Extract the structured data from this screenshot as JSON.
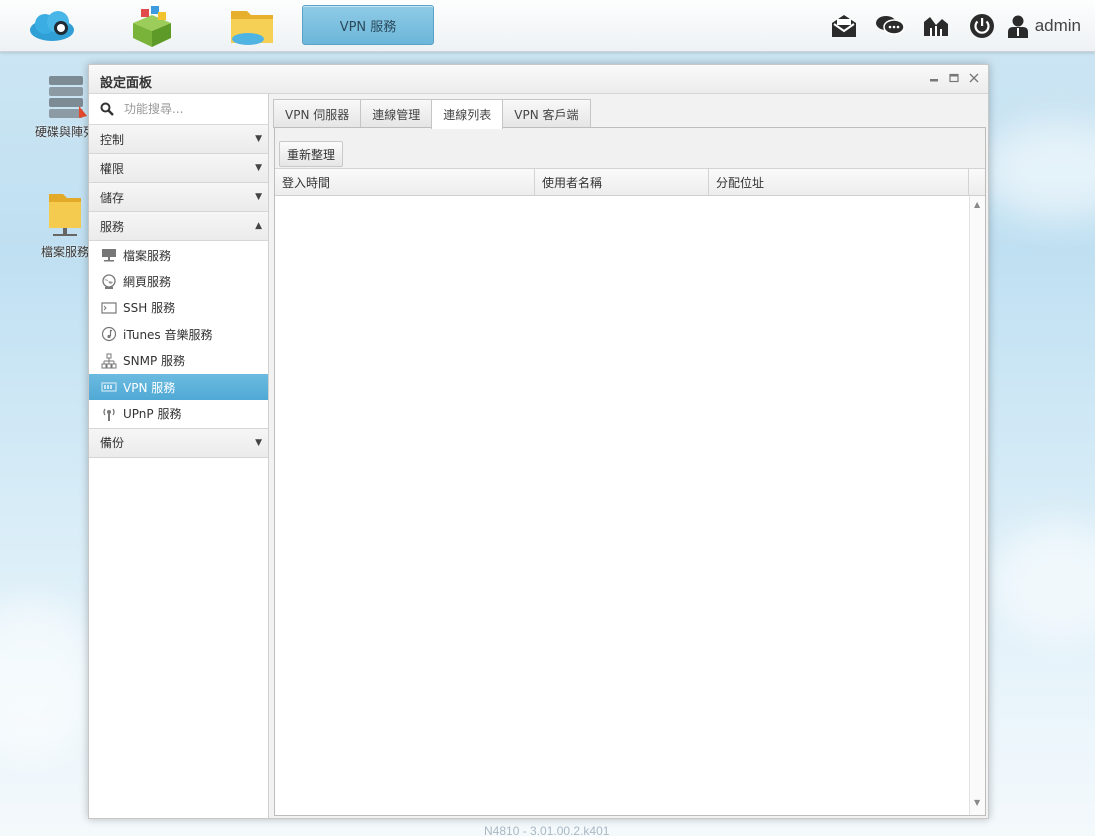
{
  "taskbar": {
    "apps": [
      "cloud-app-icon",
      "app-store-icon",
      "file-manager-icon"
    ],
    "active_app_label": "VPN 服務",
    "right_icons": [
      "mail-icon",
      "chat-icon",
      "monitor-icon",
      "power-icon",
      "user-icon"
    ],
    "username": "admin"
  },
  "desktop": {
    "icons": [
      {
        "label": "硬碟與陣列",
        "icon": "disk-array-icon"
      },
      {
        "label": "檔案服務",
        "icon": "file-service-icon"
      }
    ]
  },
  "window": {
    "title": "設定面板",
    "controls": [
      "minimize",
      "maximize",
      "close"
    ]
  },
  "sidebar": {
    "search_placeholder": "功能搜尋...",
    "categories": [
      {
        "label": "控制",
        "expanded": false
      },
      {
        "label": "權限",
        "expanded": false
      },
      {
        "label": "儲存",
        "expanded": false
      },
      {
        "label": "服務",
        "expanded": true
      },
      {
        "label": "備份",
        "expanded": false
      }
    ],
    "service_items": [
      {
        "label": "檔案服務",
        "icon": "file-service-icon",
        "selected": false
      },
      {
        "label": "網頁服務",
        "icon": "web-service-icon",
        "selected": false
      },
      {
        "label": "SSH 服務",
        "icon": "terminal-icon",
        "selected": false
      },
      {
        "label": "iTunes 音樂服務",
        "icon": "music-icon",
        "selected": false
      },
      {
        "label": "SNMP 服務",
        "icon": "network-tree-icon",
        "selected": false
      },
      {
        "label": "VPN 服務",
        "icon": "vpn-icon",
        "selected": true
      },
      {
        "label": "UPnP 服務",
        "icon": "antenna-icon",
        "selected": false
      }
    ]
  },
  "tabs": [
    {
      "label": "VPN 伺服器",
      "active": false
    },
    {
      "label": "連線管理",
      "active": false
    },
    {
      "label": "連線列表",
      "active": true
    },
    {
      "label": "VPN 客戶端",
      "active": false
    }
  ],
  "toolbar": {
    "refresh_label": "重新整理"
  },
  "grid": {
    "columns": [
      "登入時間",
      "使用者名稱",
      "分配位址"
    ],
    "rows": []
  },
  "footer": {
    "version": "N4810 - 3.01.00.2.k401"
  },
  "colors": {
    "accent": "#5aaed8",
    "selected_bg": "#4fa9d5"
  }
}
